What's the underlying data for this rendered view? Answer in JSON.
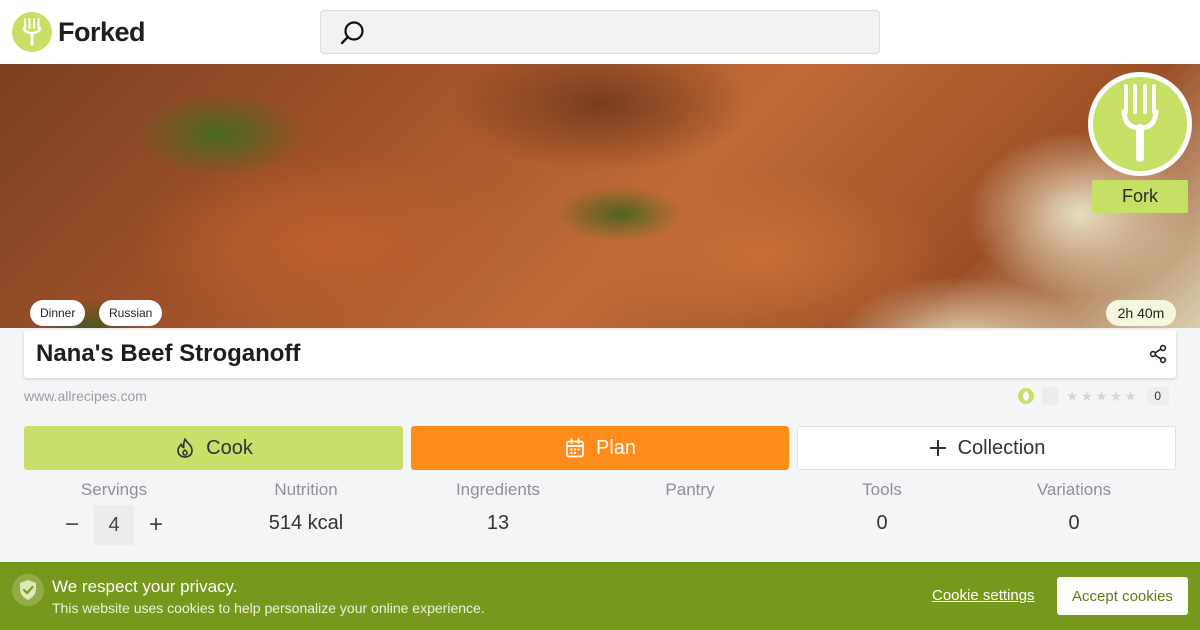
{
  "header": {
    "logo_text": "Forked",
    "logo_icon": "fork-icon",
    "search": {
      "placeholder": "",
      "icon": "search-icon"
    }
  },
  "hero": {
    "image_subject": "beef stroganoff",
    "fork_badge_icon": "fork-icon",
    "fork_button_label": "Fork",
    "tags": [
      "Dinner",
      "Russian"
    ],
    "time": "2h 40m"
  },
  "recipe": {
    "title": "Nana's Beef Stroganoff",
    "source": "www.allrecipes.com",
    "share_icon": "share-icon",
    "rating": {
      "stars": 0,
      "max_stars": 5,
      "count": "0"
    }
  },
  "actions": {
    "cook_label": "Cook",
    "plan_label": "Plan",
    "collection_label": "Collection",
    "cook_icon": "flame-icon",
    "plan_icon": "calendar-icon",
    "collection_icon": "plus-icon"
  },
  "stats": {
    "servings": {
      "label": "Servings",
      "value": "4",
      "minus": "−",
      "plus": "+"
    },
    "nutrition": {
      "label": "Nutrition",
      "value": "514 kcal"
    },
    "ingredients": {
      "label": "Ingredients",
      "value": "13"
    },
    "pantry": {
      "label": "Pantry",
      "value": ""
    },
    "tools": {
      "label": "Tools",
      "value": "0"
    },
    "variations": {
      "label": "Variations",
      "value": "0"
    }
  },
  "cookie_banner": {
    "title": "We respect your privacy.",
    "text": "This website uses cookies to help personalize your online experience.",
    "settings_label": "Cookie settings",
    "accept_label": "Accept cookies",
    "icon": "shield-check-icon"
  },
  "colors": {
    "brand_green": "#c5e065",
    "plan_orange": "#ff8c1a",
    "banner_green": "#76981c"
  }
}
